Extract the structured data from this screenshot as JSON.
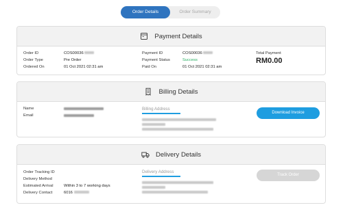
{
  "tabs": [
    {
      "label": "Order Details",
      "active": true
    },
    {
      "label": "Order Summary",
      "active": false
    }
  ],
  "payment": {
    "title": "Payment Details",
    "icon": "document-icon",
    "order_id_label": "Order ID",
    "order_id_value": "COS00036",
    "order_type_label": "Order Type",
    "order_type_value": "Pre Order",
    "ordered_on_label": "Ordered On",
    "ordered_on_value": "01 Oct 2021 02:31 am",
    "payment_id_label": "Payment ID",
    "payment_id_value": "COS00036",
    "payment_status_label": "Payment Status",
    "payment_status_value": "Success",
    "paid_on_label": "Paid On",
    "paid_on_value": "01 Oct 2021 02:31 am",
    "total_label": "Total Payment",
    "total_value": "RM0.00"
  },
  "billing": {
    "title": "Billing Details",
    "icon": "receipt-icon",
    "name_label": "Name",
    "email_label": "Email",
    "address_title": "Billing Address",
    "download_button": "Download Invoice"
  },
  "delivery": {
    "title": "Delivery Details",
    "icon": "truck-icon",
    "tracking_label": "Order Tracking ID",
    "method_label": "Delivery Method",
    "arrival_label": "Estimated Arrival",
    "arrival_value": "Within 3 to 7 working days",
    "contact_label": "Delivery Contact",
    "contact_value": "6016",
    "address_title": "Delivery Address",
    "track_button": "Track Order"
  },
  "colors": {
    "accent": "#2f74bf",
    "button": "#1e9de0",
    "success": "#27ae60",
    "disabled": "#d6d6d6"
  }
}
